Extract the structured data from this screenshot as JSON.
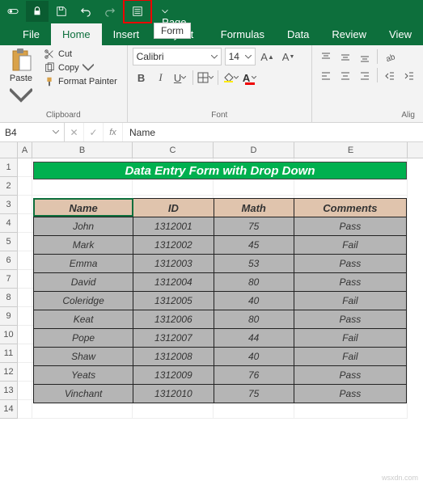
{
  "titlebar": {
    "form_tooltip": "Form"
  },
  "tabs": {
    "file": "File",
    "home": "Home",
    "insert": "Insert",
    "page_layout": "Page Layout",
    "formulas": "Formulas",
    "data": "Data",
    "review": "Review",
    "view": "View"
  },
  "clipboard": {
    "paste": "Paste",
    "cut": "Cut",
    "copy": "Copy",
    "format_painter": "Format Painter",
    "group_label": "Clipboard"
  },
  "font": {
    "name": "Calibri",
    "size": "14",
    "group_label": "Font"
  },
  "alignment": {
    "group_label": "Alig"
  },
  "formula_bar": {
    "cell_ref": "B4",
    "value": "Name"
  },
  "columns": [
    "A",
    "B",
    "C",
    "D",
    "E"
  ],
  "rows": [
    "1",
    "2",
    "3",
    "4",
    "5",
    "6",
    "7",
    "8",
    "9",
    "10",
    "11",
    "12",
    "13",
    "14"
  ],
  "sheet": {
    "title": "Data Entry Form with Drop Down",
    "headers": {
      "name": "Name",
      "id": "ID",
      "math": "Math",
      "comments": "Comments"
    },
    "data": [
      {
        "name": "John",
        "id": "1312001",
        "math": "75",
        "comments": "Pass"
      },
      {
        "name": "Mark",
        "id": "1312002",
        "math": "45",
        "comments": "Fail"
      },
      {
        "name": "Emma",
        "id": "1312003",
        "math": "53",
        "comments": "Pass"
      },
      {
        "name": "David",
        "id": "1312004",
        "math": "80",
        "comments": "Pass"
      },
      {
        "name": "Coleridge",
        "id": "1312005",
        "math": "40",
        "comments": "Fail"
      },
      {
        "name": "Keat",
        "id": "1312006",
        "math": "80",
        "comments": "Pass"
      },
      {
        "name": "Pope",
        "id": "1312007",
        "math": "44",
        "comments": "Fail"
      },
      {
        "name": "Shaw",
        "id": "1312008",
        "math": "40",
        "comments": "Fail"
      },
      {
        "name": "Yeats",
        "id": "1312009",
        "math": "76",
        "comments": "Pass"
      },
      {
        "name": "Vinchant",
        "id": "1312010",
        "math": "75",
        "comments": "Pass"
      }
    ]
  },
  "watermark": "wsxdn.com"
}
